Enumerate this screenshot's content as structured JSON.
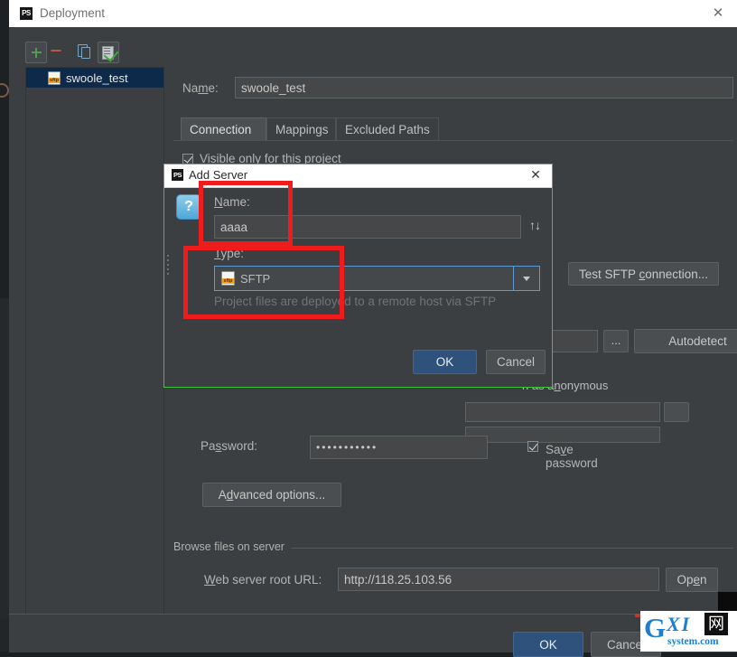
{
  "window": {
    "title": "Deployment",
    "app_icon": "phpstorm-icon",
    "close_icon": "close-icon"
  },
  "sidebar": {
    "toolbar": [
      {
        "name": "add-server-button",
        "icon": "plus-icon",
        "label": "+"
      },
      {
        "name": "remove-server-button",
        "icon": "minus-icon",
        "label": "−"
      },
      {
        "name": "copy-server-button",
        "icon": "copy-icon",
        "label": ""
      },
      {
        "name": "set-default-button",
        "icon": "checked-sheet-icon",
        "label": ""
      }
    ],
    "servers": [
      {
        "name": "swoole_test",
        "icon": "sftp-icon",
        "selected": true
      }
    ]
  },
  "form": {
    "name_label": "Name:",
    "name_value": "swoole_test",
    "tabs": [
      {
        "label": "Connection",
        "active": true
      },
      {
        "label": "Mappings",
        "active": false
      },
      {
        "label": "Excluded Paths",
        "active": false
      }
    ],
    "visible_only_label": "Visible only for this project",
    "visible_only_checked": true,
    "type_label": "Type:",
    "type_value": "SFTP",
    "type_icon": "sftp-icon",
    "test_connection_label": "Test SFTP connection...",
    "autodetect_label": "Autodetect",
    "browse_dots_label": "...",
    "anonymous_label": "n as anonymous",
    "password_label": "Password:",
    "password_value": "•••••••••••",
    "save_password_label": "Save password",
    "save_password_checked": true,
    "advanced_options_label": "Advanced options...",
    "browse_group_label": "Browse files on server",
    "url_label": "Web server root URL:",
    "url_value": "http://118.25.103.56",
    "open_label": "Open"
  },
  "bottom": {
    "ok_label": "OK",
    "cancel_label": "Cancel"
  },
  "dialog": {
    "title": "Add Server",
    "app_icon": "phpstorm-icon",
    "close_icon": "close-icon",
    "help_icon": "question-mark-icon",
    "name_label": "Name:",
    "name_value": "aaaa",
    "swap_icon": "up-down-arrows-icon",
    "type_label": "Type:",
    "type_value": "SFTP",
    "type_icon": "sftp-icon",
    "hint": "Project files are deployed to a remote host via SFTP",
    "ok_label": "OK",
    "cancel_label": "Cancel"
  },
  "annotations": {
    "highlight_color": "#ee1c1c",
    "dialog_border_color": "#3cc43c",
    "boxes": [
      {
        "name": "name-field-highlight"
      },
      {
        "name": "type-field-highlight"
      }
    ]
  },
  "watermark": {
    "letter": "G",
    "initials": "XI",
    "cjk": "网",
    "domain": "system.com"
  }
}
